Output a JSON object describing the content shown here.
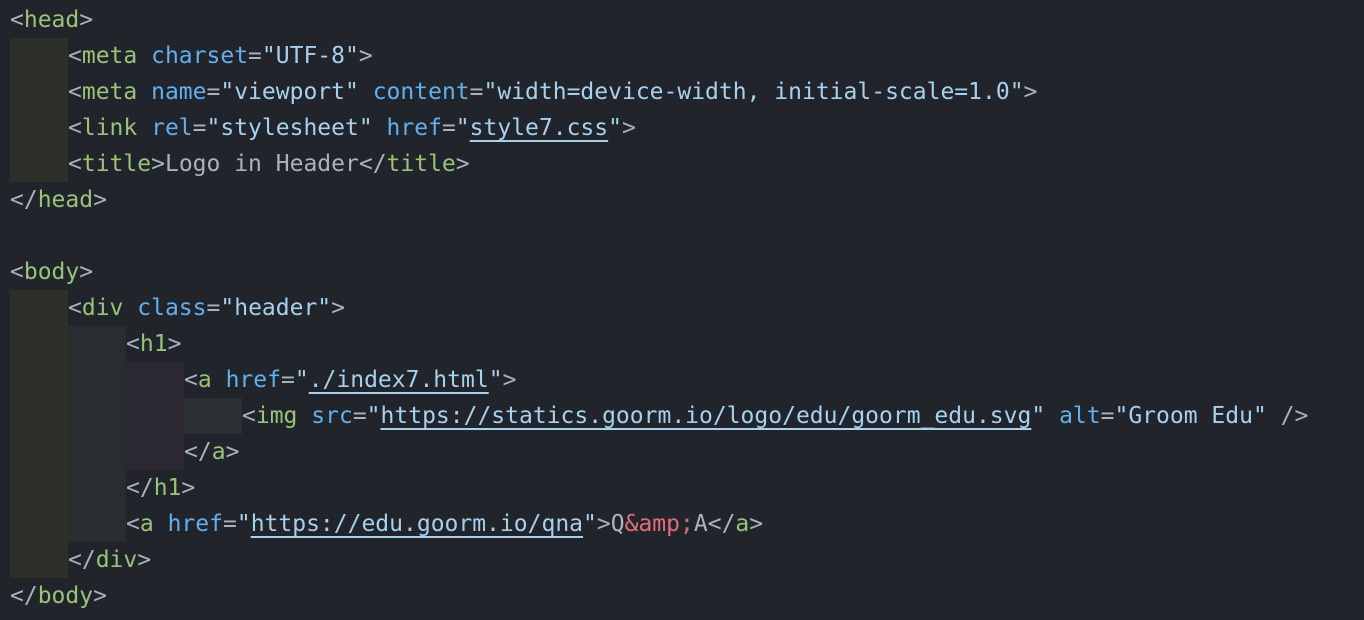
{
  "colors": {
    "background": "#21252b",
    "punctuation": "#abb2bf",
    "tag": "#98c379",
    "attribute": "#61afef",
    "string": "#a7d0ef",
    "text": "#abb2bf",
    "entity": "#e06c75"
  },
  "lines": [
    {
      "indent": 0,
      "tokens": [
        {
          "t": "<",
          "c": "punctuation"
        },
        {
          "t": "head",
          "c": "tag"
        },
        {
          "t": ">",
          "c": "punctuation"
        }
      ]
    },
    {
      "indent": 1,
      "tokens": [
        {
          "t": "<",
          "c": "punctuation"
        },
        {
          "t": "meta",
          "c": "tag"
        },
        {
          "t": " ",
          "c": "text"
        },
        {
          "t": "charset",
          "c": "attribute"
        },
        {
          "t": "=",
          "c": "punctuation"
        },
        {
          "t": "\"UTF-8\"",
          "c": "string"
        },
        {
          "t": ">",
          "c": "punctuation"
        }
      ]
    },
    {
      "indent": 1,
      "tokens": [
        {
          "t": "<",
          "c": "punctuation"
        },
        {
          "t": "meta",
          "c": "tag"
        },
        {
          "t": " ",
          "c": "text"
        },
        {
          "t": "name",
          "c": "attribute"
        },
        {
          "t": "=",
          "c": "punctuation"
        },
        {
          "t": "\"viewport\"",
          "c": "string"
        },
        {
          "t": " ",
          "c": "text"
        },
        {
          "t": "content",
          "c": "attribute"
        },
        {
          "t": "=",
          "c": "punctuation"
        },
        {
          "t": "\"width=device-width, initial-scale=1.0\"",
          "c": "string"
        },
        {
          "t": ">",
          "c": "punctuation"
        }
      ]
    },
    {
      "indent": 1,
      "tokens": [
        {
          "t": "<",
          "c": "punctuation"
        },
        {
          "t": "link",
          "c": "tag"
        },
        {
          "t": " ",
          "c": "text"
        },
        {
          "t": "rel",
          "c": "attribute"
        },
        {
          "t": "=",
          "c": "punctuation"
        },
        {
          "t": "\"stylesheet\"",
          "c": "string"
        },
        {
          "t": " ",
          "c": "text"
        },
        {
          "t": "href",
          "c": "attribute"
        },
        {
          "t": "=",
          "c": "punctuation"
        },
        {
          "t": "\"",
          "c": "string"
        },
        {
          "t": "style7.css",
          "c": "string",
          "u": true
        },
        {
          "t": "\"",
          "c": "string"
        },
        {
          "t": ">",
          "c": "punctuation"
        }
      ]
    },
    {
      "indent": 1,
      "tokens": [
        {
          "t": "<",
          "c": "punctuation"
        },
        {
          "t": "title",
          "c": "tag"
        },
        {
          "t": ">",
          "c": "punctuation"
        },
        {
          "t": "Logo in Header",
          "c": "text"
        },
        {
          "t": "</",
          "c": "punctuation"
        },
        {
          "t": "title",
          "c": "tag"
        },
        {
          "t": ">",
          "c": "punctuation"
        }
      ]
    },
    {
      "indent": 0,
      "tokens": [
        {
          "t": "</",
          "c": "punctuation"
        },
        {
          "t": "head",
          "c": "tag"
        },
        {
          "t": ">",
          "c": "punctuation"
        }
      ]
    },
    {
      "indent": 0,
      "tokens": []
    },
    {
      "indent": 0,
      "tokens": [
        {
          "t": "<",
          "c": "punctuation"
        },
        {
          "t": "body",
          "c": "tag"
        },
        {
          "t": ">",
          "c": "punctuation"
        }
      ]
    },
    {
      "indent": 1,
      "tokens": [
        {
          "t": "<",
          "c": "punctuation"
        },
        {
          "t": "div",
          "c": "tag"
        },
        {
          "t": " ",
          "c": "text"
        },
        {
          "t": "class",
          "c": "attribute"
        },
        {
          "t": "=",
          "c": "punctuation"
        },
        {
          "t": "\"header\"",
          "c": "string"
        },
        {
          "t": ">",
          "c": "punctuation"
        }
      ]
    },
    {
      "indent": 2,
      "tokens": [
        {
          "t": "<",
          "c": "punctuation"
        },
        {
          "t": "h1",
          "c": "tag"
        },
        {
          "t": ">",
          "c": "punctuation"
        }
      ]
    },
    {
      "indent": 3,
      "tokens": [
        {
          "t": "<",
          "c": "punctuation"
        },
        {
          "t": "a",
          "c": "tag"
        },
        {
          "t": " ",
          "c": "text"
        },
        {
          "t": "href",
          "c": "attribute"
        },
        {
          "t": "=",
          "c": "punctuation"
        },
        {
          "t": "\"",
          "c": "string"
        },
        {
          "t": "./index7.html",
          "c": "string",
          "u": true
        },
        {
          "t": "\"",
          "c": "string"
        },
        {
          "t": ">",
          "c": "punctuation"
        }
      ]
    },
    {
      "indent": 4,
      "tokens": [
        {
          "t": "<",
          "c": "punctuation"
        },
        {
          "t": "img",
          "c": "tag"
        },
        {
          "t": " ",
          "c": "text"
        },
        {
          "t": "src",
          "c": "attribute"
        },
        {
          "t": "=",
          "c": "punctuation"
        },
        {
          "t": "\"",
          "c": "string"
        },
        {
          "t": "https://statics.goorm.io/logo/edu/goorm_edu.svg",
          "c": "string",
          "u": true
        },
        {
          "t": "\"",
          "c": "string"
        },
        {
          "t": " ",
          "c": "text"
        },
        {
          "t": "alt",
          "c": "attribute"
        },
        {
          "t": "=",
          "c": "punctuation"
        },
        {
          "t": "\"Groom Edu\"",
          "c": "string"
        },
        {
          "t": " />",
          "c": "punctuation"
        }
      ]
    },
    {
      "indent": 3,
      "tokens": [
        {
          "t": "</",
          "c": "punctuation"
        },
        {
          "t": "a",
          "c": "tag"
        },
        {
          "t": ">",
          "c": "punctuation"
        }
      ]
    },
    {
      "indent": 2,
      "tokens": [
        {
          "t": "</",
          "c": "punctuation"
        },
        {
          "t": "h1",
          "c": "tag"
        },
        {
          "t": ">",
          "c": "punctuation"
        }
      ]
    },
    {
      "indent": 2,
      "tokens": [
        {
          "t": "<",
          "c": "punctuation"
        },
        {
          "t": "a",
          "c": "tag"
        },
        {
          "t": " ",
          "c": "text"
        },
        {
          "t": "href",
          "c": "attribute"
        },
        {
          "t": "=",
          "c": "punctuation"
        },
        {
          "t": "\"",
          "c": "string"
        },
        {
          "t": "https://edu.goorm.io/qna",
          "c": "string",
          "u": true
        },
        {
          "t": "\"",
          "c": "string"
        },
        {
          "t": ">",
          "c": "punctuation"
        },
        {
          "t": "Q",
          "c": "text"
        },
        {
          "t": "&amp;",
          "c": "entity"
        },
        {
          "t": "A",
          "c": "text"
        },
        {
          "t": "</",
          "c": "punctuation"
        },
        {
          "t": "a",
          "c": "tag"
        },
        {
          "t": ">",
          "c": "punctuation"
        }
      ]
    },
    {
      "indent": 1,
      "tokens": [
        {
          "t": "</",
          "c": "punctuation"
        },
        {
          "t": "div",
          "c": "tag"
        },
        {
          "t": ">",
          "c": "punctuation"
        }
      ]
    },
    {
      "indent": 0,
      "tokens": [
        {
          "t": "</",
          "c": "punctuation"
        },
        {
          "t": "body",
          "c": "tag"
        },
        {
          "t": ">",
          "c": "punctuation"
        }
      ]
    }
  ]
}
